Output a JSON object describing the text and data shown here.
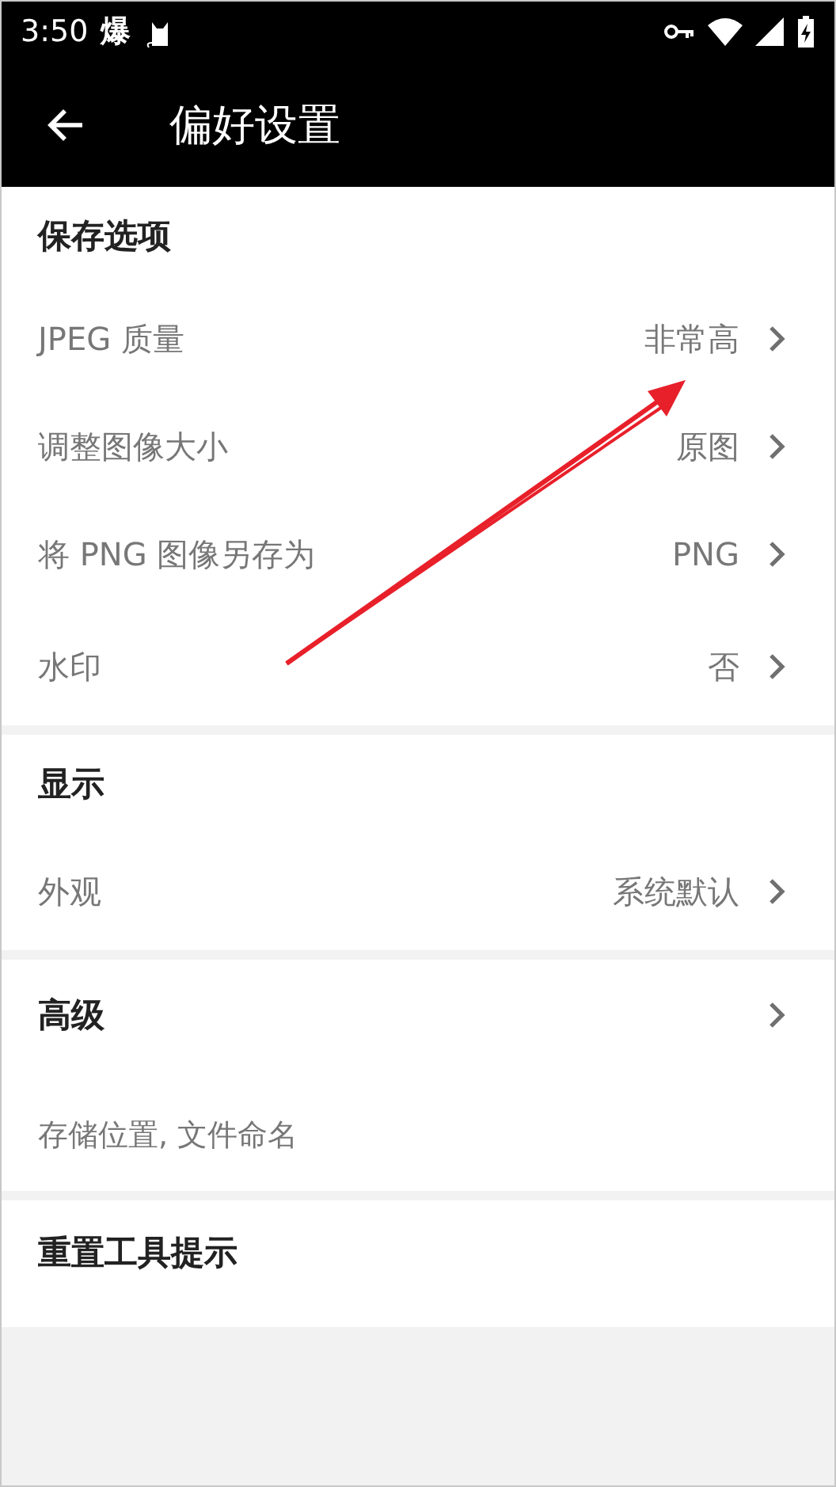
{
  "status_bar": {
    "time": "3:50",
    "notification_text": "爆"
  },
  "app_bar": {
    "title": "偏好设置"
  },
  "sections": [
    {
      "kind": "group",
      "title": "保存选项",
      "items": [
        {
          "label": "JPEG 质量",
          "value": "非常高"
        },
        {
          "label": "调整图像大小",
          "value": "原图"
        },
        {
          "label": "将 PNG 图像另存为",
          "value": "PNG"
        },
        {
          "label": "水印",
          "value": "否"
        }
      ]
    },
    {
      "kind": "group",
      "title": "显示",
      "items": [
        {
          "label": "外观",
          "value": "系统默认"
        }
      ]
    },
    {
      "kind": "link",
      "title": "高级",
      "subtitle": "存储位置, 文件命名"
    },
    {
      "kind": "plain",
      "title": "重置工具提示"
    }
  ]
}
